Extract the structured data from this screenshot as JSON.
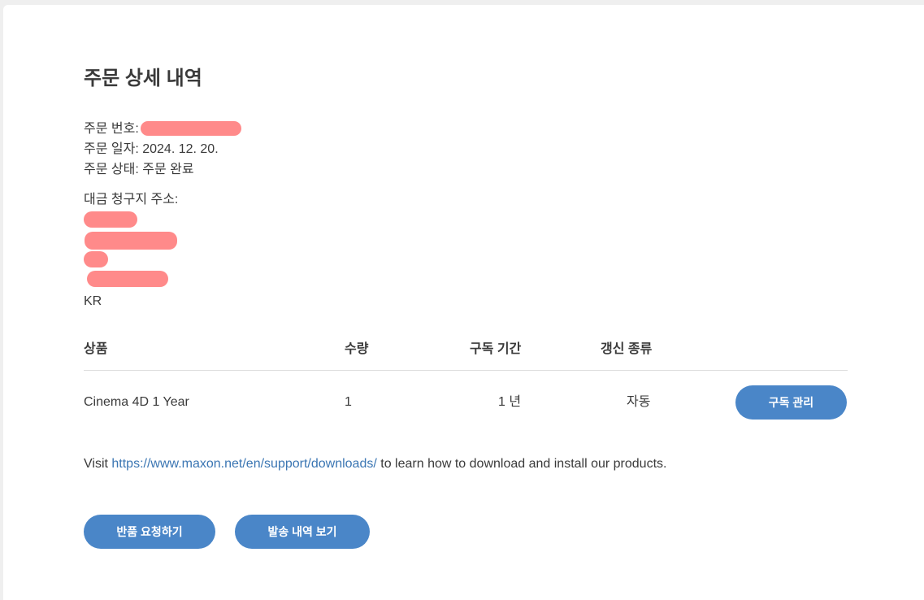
{
  "page": {
    "title": "주문 상세 내역"
  },
  "order": {
    "number_label": "주문 번호:",
    "date_label": "주문 일자:",
    "date_value": "2024. 12. 20.",
    "status_label": "주문 상태:",
    "status_value": "주문 완료",
    "billing_label": "대금 청구지 주소:",
    "billing_country": "KR"
  },
  "table": {
    "headers": {
      "product": "상품",
      "quantity": "수량",
      "period": "구독 기간",
      "renewal": "갱신 종류"
    },
    "rows": [
      {
        "product": "Cinema 4D 1 Year",
        "quantity": "1",
        "period": "1 년",
        "renewal": "자동",
        "action_label": "구독 관리"
      }
    ]
  },
  "visit": {
    "prefix": "Visit",
    "link_text": "https://www.maxon.net/en/support/downloads/",
    "suffix": "to learn how to download and install our products."
  },
  "actions": {
    "return_label": "반품 요청하기",
    "shipping_label": "발송 내역 보기"
  },
  "colors": {
    "button": "#4a86c8",
    "link": "#3b76b3",
    "redaction": "#ff8a8a"
  }
}
